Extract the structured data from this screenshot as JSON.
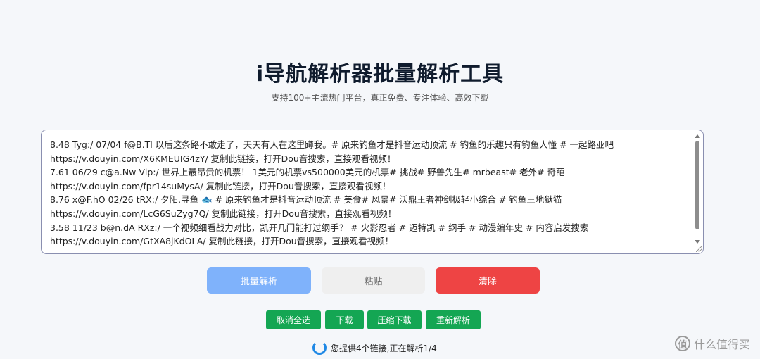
{
  "header": {
    "title": "i导航解析器批量解析工具",
    "subtitle": "支持100+主流热门平台，真正免费、专注体验、高效下载"
  },
  "input": {
    "lines": [
      "8.48 Tyg:/ 07/04 f@B.Tl 以后这条路不敢走了，天天有人在这里蹲我。# 原来钓鱼才是抖音运动顶流 # 钓鱼的乐趣只有钓鱼人懂 # 一起路亚吧",
      "https://v.douyin.com/X6KMEUIG4zY/ 复制此链接，打开Dou音搜索，直接观看视频！",
      "7.61 06/29 c@a.Nw Vlp:/ 世界上最昂贵的机票！  1美元的机票vs500000美元的机票# 挑战# 野兽先生# mrbeast# 老外# 奇葩",
      "https://v.douyin.com/fpr14suMysA/ 复制此链接，打开Dou音搜索，直接观看视频！",
      "8.76 x@F.hO 02/26 tRX:/ 夕阳.寻鱼 🐟 # 原来钓鱼才是抖音运动顶流 # 美食# 风景# 沃鼎王者神剑极轻小综合 # 钓鱼王地狱猫",
      "https://v.douyin.com/LcG6SuZyg7Q/ 复制此链接，打开Dou音搜索，直接观看视频！",
      "3.58 11/23 b@n.dA RXz:/ 一个视频细看战力对比，凯开几门能打过纲手？ # 火影忍者 # 迈特凯 # 纲手 # 动漫编年史 # 内容启发搜索",
      "https://v.douyin.com/GtXA8jKdOLA/ 复制此链接，打开Dou音搜索，直接观看视频！"
    ]
  },
  "buttons": {
    "parse": "批量解析",
    "paste": "粘贴",
    "clear": "清除"
  },
  "actions": {
    "deselect": "取消全选",
    "download": "下载",
    "zip_download": "压缩下载",
    "reparse": "重新解析"
  },
  "status": {
    "text": "您提供4个链接,正在解析1/4"
  },
  "watermark": {
    "badge": "值",
    "text": "什么值得买"
  },
  "colors": {
    "parse_button": "#7fb2fb",
    "clear_button": "#ee4444",
    "action_button": "#14a653",
    "spinner": "#1e88e5"
  }
}
